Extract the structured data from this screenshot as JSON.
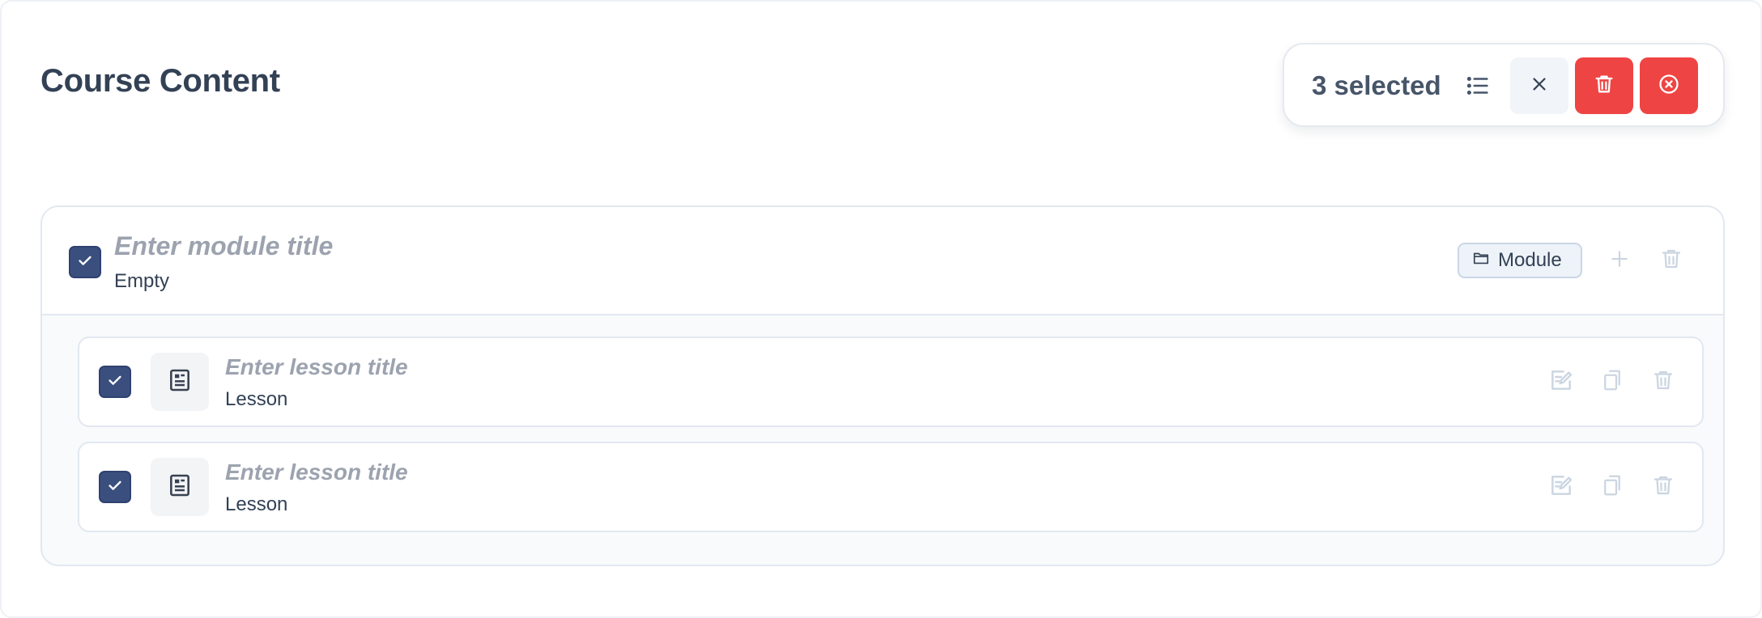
{
  "page": {
    "title": "Course Content"
  },
  "selection_bar": {
    "count_label": "3 selected",
    "icons": [
      "list-icon",
      "close-icon",
      "trash-icon",
      "circle-x-icon"
    ],
    "colors": {
      "danger": "#ef4444",
      "neutral": "#f1f4f8"
    }
  },
  "module": {
    "checked": true,
    "title_placeholder": "Enter module title",
    "subtitle": "Empty",
    "badge_label": "Module",
    "lessons": [
      {
        "checked": true,
        "title_placeholder": "Enter lesson title",
        "subtitle": "Lesson"
      },
      {
        "checked": true,
        "title_placeholder": "Enter lesson title",
        "subtitle": "Lesson"
      }
    ]
  },
  "colors": {
    "checkbox": "#3b4f7e",
    "text": "#334155",
    "placeholder": "#9ca3af"
  }
}
